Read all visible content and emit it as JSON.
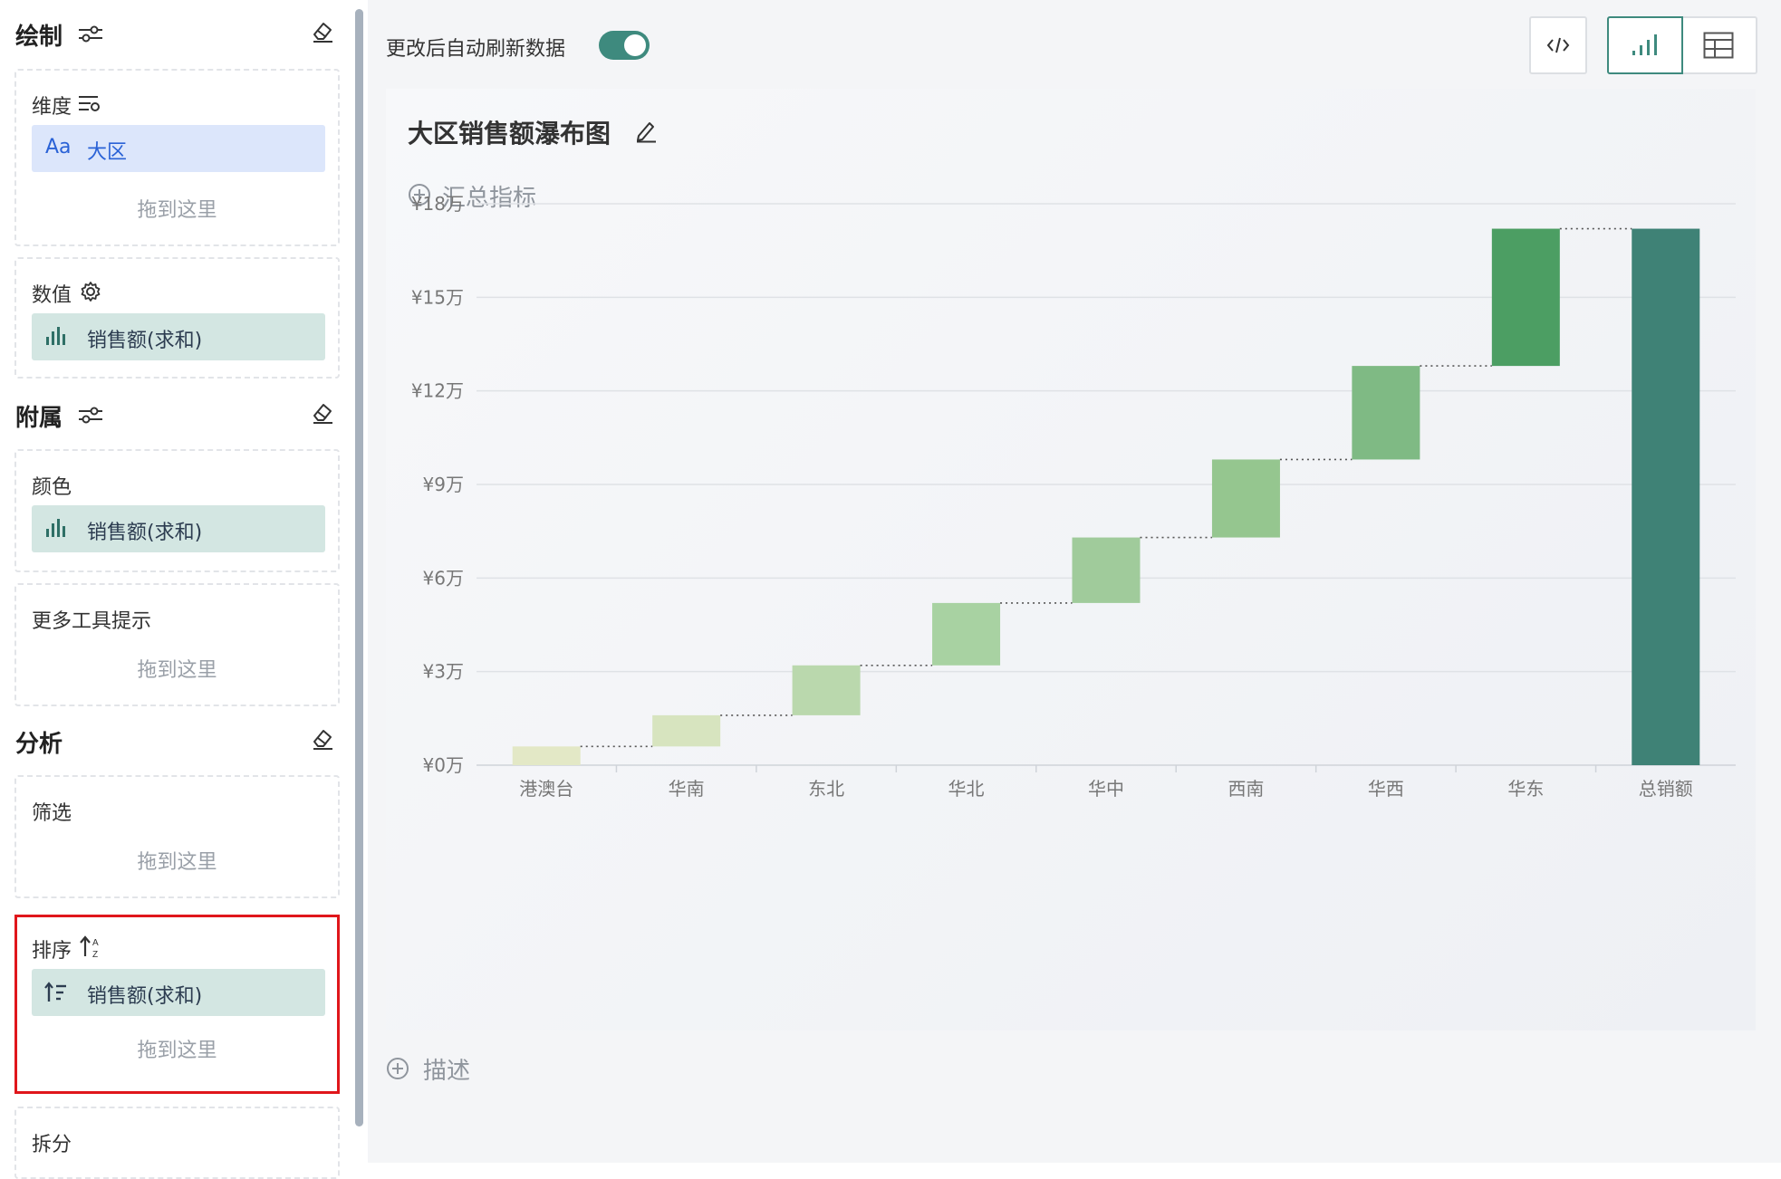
{
  "left_panel": {
    "sections": {
      "draw": {
        "title": "绘制"
      },
      "attach": {
        "title": "附属"
      },
      "analysis": {
        "title": "分析"
      }
    },
    "boxes": {
      "dimension": {
        "label": "维度",
        "chip": "大区",
        "chip_prefix": "Aa",
        "hint": "拖到这里"
      },
      "value": {
        "label": "数值",
        "chip": "销售额(求和)"
      },
      "color": {
        "label": "颜色",
        "chip": "销售额(求和)"
      },
      "tooltip": {
        "label": "更多工具提示",
        "hint": "拖到这里"
      },
      "filter": {
        "label": "筛选",
        "hint": "拖到这里"
      },
      "sort": {
        "label": "排序",
        "chip": "销售额(求和)",
        "hint": "拖到这里"
      },
      "split": {
        "label": "拆分"
      }
    },
    "highlight_color": "#e0161b"
  },
  "toolbar": {
    "auto_refresh_label": "更改后自动刷新数据",
    "auto_refresh_on": true,
    "accent_color": "#3e8a7e",
    "buttons": [
      "code-icon",
      "bar-chart-icon",
      "table-icon"
    ]
  },
  "chart_card": {
    "title": "大区销售额瀑布图",
    "summary_label": "汇总指标",
    "description_label": "描述"
  },
  "chart_data": {
    "type": "bar",
    "subtype": "waterfall",
    "categories": [
      "港澳台",
      "华南",
      "东北",
      "华北",
      "华中",
      "西南",
      "华西",
      "华东",
      "总销额"
    ],
    "increments": [
      0.6,
      1.0,
      1.6,
      2.0,
      2.1,
      2.5,
      3.0,
      4.4,
      17.2
    ],
    "is_total": [
      false,
      false,
      false,
      false,
      false,
      false,
      false,
      false,
      true
    ],
    "unit": "万",
    "currency": "¥",
    "y_ticks": [
      0,
      3,
      6,
      9,
      12,
      15,
      18
    ],
    "y_tick_labels": [
      "¥0万",
      "¥3万",
      "¥6万",
      "¥9万",
      "¥12万",
      "¥15万",
      "¥18万"
    ],
    "ylim": [
      0,
      18
    ],
    "grid": true,
    "connector_lines": "dotted",
    "colors": [
      "#e3e8c6",
      "#d7e4bf",
      "#bad8ad",
      "#a8d2a2",
      "#a0cb9b",
      "#95c68f",
      "#7fba84",
      "#4c9e63",
      "#3f8276"
    ]
  }
}
